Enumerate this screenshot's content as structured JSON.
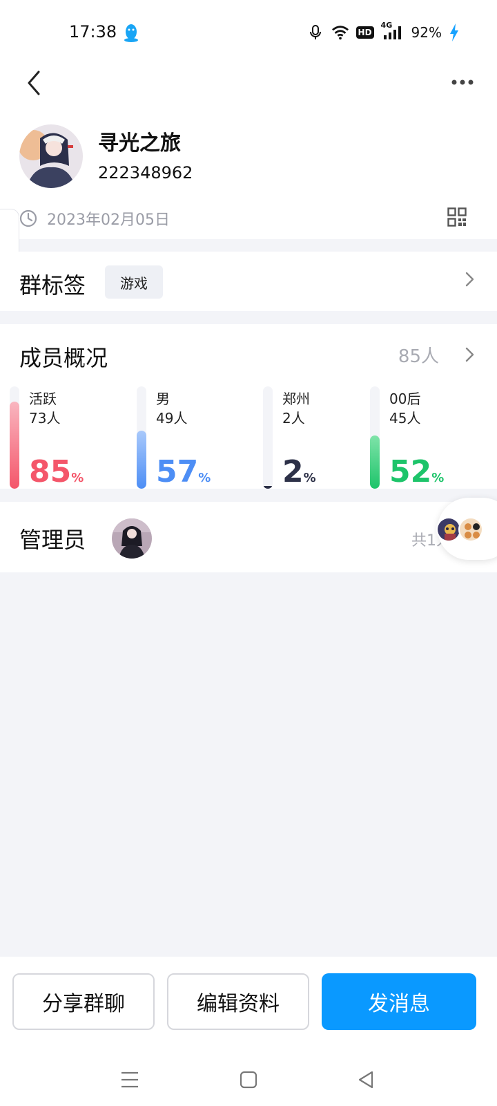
{
  "status_bar": {
    "time": "17:38",
    "battery_text": "92%",
    "hd_label": "HD",
    "network_label": "4G",
    "icons": [
      "qq-penguin-icon",
      "microphone-icon",
      "wifi-icon",
      "hd-icon",
      "signal-4g-icon",
      "charging-icon"
    ]
  },
  "nav": {
    "back_icon": "chevron-left-icon",
    "more_icon": "more-dots-icon"
  },
  "group": {
    "name": "寻光之旅",
    "id": "222348962",
    "created_date": "2023年02月05日"
  },
  "tags": {
    "title": "群标签",
    "items": [
      "游戏"
    ]
  },
  "members": {
    "title": "成员概况",
    "count": "85人",
    "stats": [
      {
        "label": "活跃",
        "count": "73人",
        "percent": "85",
        "sign": "%",
        "fill": 0.85,
        "color": "#f4566a",
        "fill_top": "#f9b6c0"
      },
      {
        "label": "男",
        "count": "49人",
        "percent": "57",
        "sign": "%",
        "fill": 0.57,
        "color": "#4d8ef5",
        "fill_top": "#a9c9fb"
      },
      {
        "label": "郑州",
        "count": "2人",
        "percent": "2",
        "sign": "%",
        "fill": 0.02,
        "color": "#2d3148",
        "fill_top": "#2d3148"
      },
      {
        "label": "00后",
        "count": "45人",
        "percent": "52",
        "sign": "%",
        "fill": 0.52,
        "color": "#1dc46a",
        "fill_top": "#7fe3a9"
      }
    ]
  },
  "admin": {
    "title": "管理员",
    "total": "共1人"
  },
  "actions": {
    "share": "分享群聊",
    "edit": "编辑资料",
    "send": "发消息"
  },
  "colors": {
    "primary": "#0a99ff",
    "page_bg": "#f3f4f8",
    "muted_text": "#a8aab2"
  }
}
